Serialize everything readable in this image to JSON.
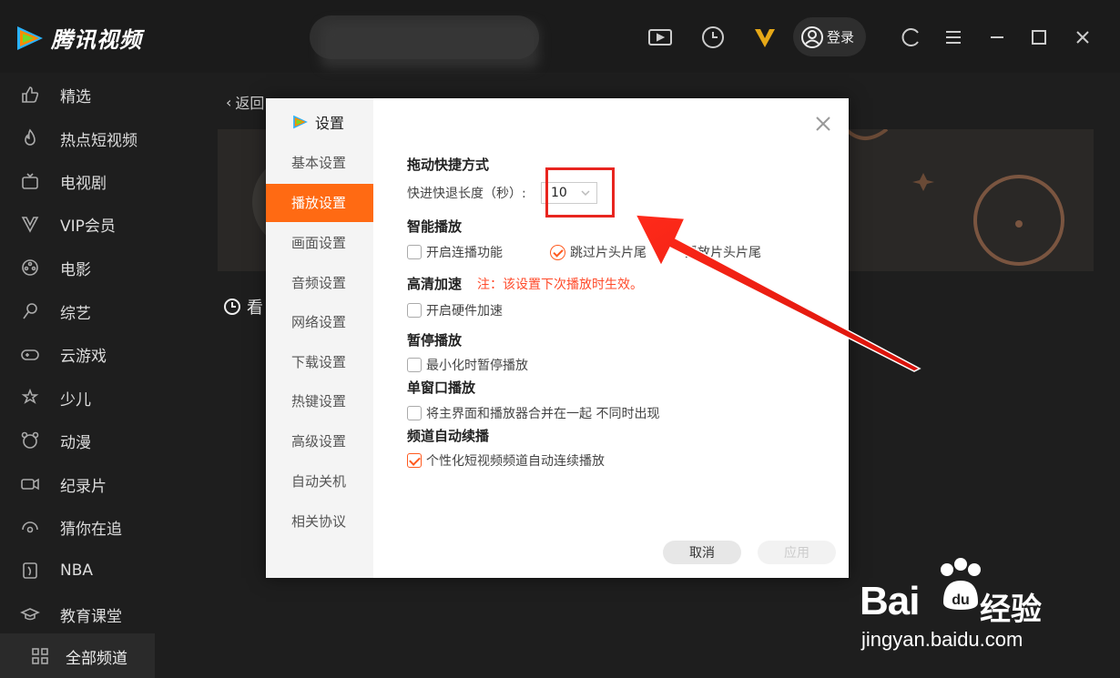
{
  "app": {
    "name": "腾讯视频"
  },
  "header": {
    "login_label": "登录"
  },
  "sidebar": {
    "items": [
      {
        "label": "精选",
        "icon": "thumbs-up-icon"
      },
      {
        "label": "热点短视频",
        "icon": "flame-icon"
      },
      {
        "label": "电视剧",
        "icon": "tv-icon"
      },
      {
        "label": "VIP会员",
        "icon": "vip-icon"
      },
      {
        "label": "电影",
        "icon": "film-reel-icon"
      },
      {
        "label": "综艺",
        "icon": "microphone-icon"
      },
      {
        "label": "云游戏",
        "icon": "gamepad-icon"
      },
      {
        "label": "少儿",
        "icon": "star-kid-icon"
      },
      {
        "label": "动漫",
        "icon": "bear-icon"
      },
      {
        "label": "纪录片",
        "icon": "camera-icon"
      },
      {
        "label": "猜你在追",
        "icon": "eye-icon"
      },
      {
        "label": "NBA",
        "icon": "basketball-icon"
      },
      {
        "label": "教育课堂",
        "icon": "graduation-cap-icon"
      }
    ],
    "all_channels": "全部频道"
  },
  "main": {
    "back_label": "返回",
    "history_label": "看"
  },
  "dialog": {
    "title": "设置",
    "tabs": [
      "基本设置",
      "播放设置",
      "画面设置",
      "音频设置",
      "网络设置",
      "下载设置",
      "热键设置",
      "高级设置",
      "自动关机",
      "相关协议"
    ],
    "active_tab": 1,
    "sections": {
      "drag": {
        "title": "拖动快捷方式",
        "label": "快进快退长度（秒）:",
        "value": "10"
      },
      "smart": {
        "title": "智能播放",
        "opt1": "开启连播功能",
        "opt2": "跳过片头片尾",
        "opt3": "播放片头片尾"
      },
      "hd": {
        "title": "高清加速",
        "note": "注：该设置下次播放时生效。",
        "opt1": "开启硬件加速"
      },
      "pause": {
        "title": "暂停播放",
        "opt1": "最小化时暂停播放"
      },
      "single": {
        "title": "单窗口播放",
        "opt1": "将主界面和播放器合并在一起 不同时出现"
      },
      "channel": {
        "title": "频道自动续播",
        "opt1": "个性化短视频频道自动连续播放"
      }
    },
    "cancel_label": "取消",
    "apply_label": "应用"
  },
  "watermark": {
    "brand": "Bai",
    "cn": "经验",
    "url": "jingyan.baidu.com"
  },
  "colors": {
    "accent": "#ff6a13",
    "annotation": "#e8251f"
  }
}
